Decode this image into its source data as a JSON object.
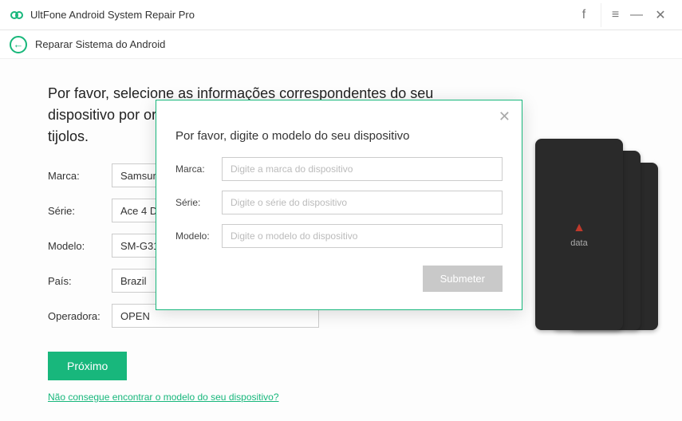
{
  "app": {
    "title": "UltFone Android System Repair Pro"
  },
  "breadcrumb": {
    "text": "Reparar Sistema do Android"
  },
  "heading": "Por favor, selecione as informações correspondentes do seu\ndispositivo por ordem, para impedir que o dispositivo seja colocado em\ntijolos.",
  "form": {
    "brand": {
      "label": "Marca:",
      "value": "Samsung"
    },
    "series": {
      "label": "Série:",
      "value": "Ace 4 Duos"
    },
    "model": {
      "label": "Modelo:",
      "value": "SM-G316M"
    },
    "country": {
      "label": "País:",
      "value": "Brazil"
    },
    "carrier": {
      "label": "Operadora:",
      "value": "OPEN"
    }
  },
  "next_button": "Próximo",
  "help_link": "Não consegue encontrar o modelo do seu dispositivo?",
  "phone_tag": "data",
  "modal": {
    "title": "Por favor, digite o modelo do seu dispositivo",
    "brand": {
      "label": "Marca:",
      "placeholder": "Digite a marca do dispositivo"
    },
    "series": {
      "label": "Série:",
      "placeholder": "Digite o série do dispositivo"
    },
    "model": {
      "label": "Modelo:",
      "placeholder": "Digite o modelo do dispositivo"
    },
    "submit": "Submeter"
  }
}
